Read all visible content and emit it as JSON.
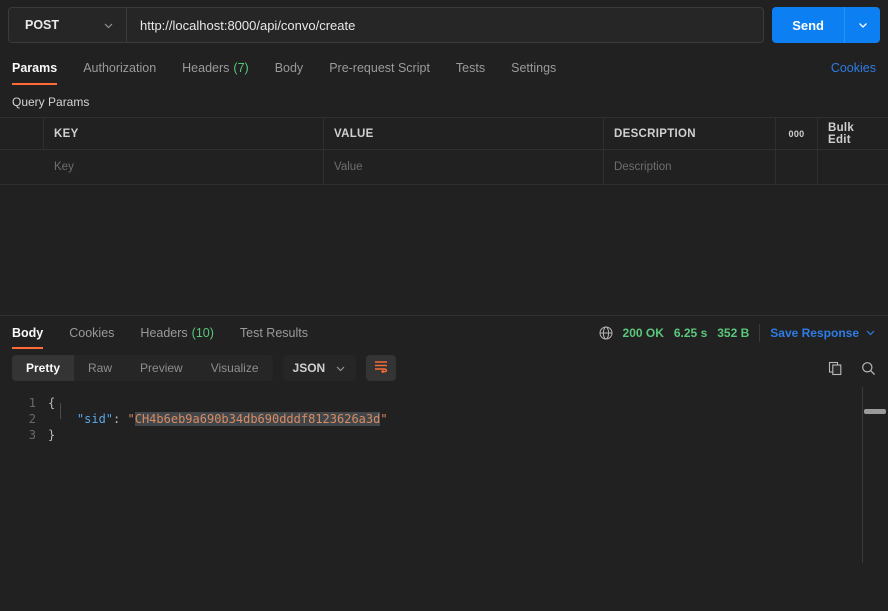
{
  "request": {
    "method": "POST",
    "url": "http://localhost:8000/api/convo/create",
    "send_label": "Send",
    "tabs": [
      {
        "label": "Params",
        "count": "",
        "active": true
      },
      {
        "label": "Authorization",
        "count": "",
        "active": false
      },
      {
        "label": "Headers",
        "count": "(7)",
        "active": false
      },
      {
        "label": "Body",
        "count": "",
        "active": false
      },
      {
        "label": "Pre-request Script",
        "count": "",
        "active": false
      },
      {
        "label": "Tests",
        "count": "",
        "active": false
      },
      {
        "label": "Settings",
        "count": "",
        "active": false
      }
    ],
    "cookies_link": "Cookies"
  },
  "params": {
    "section_title": "Query Params",
    "columns": [
      "KEY",
      "VALUE",
      "DESCRIPTION"
    ],
    "more_dots": "000",
    "bulk_edit": "Bulk Edit",
    "row_placeholders": [
      "Key",
      "Value",
      "Description"
    ]
  },
  "response": {
    "tabs": [
      {
        "label": "Body",
        "count": "",
        "active": true
      },
      {
        "label": "Cookies",
        "count": "",
        "active": false
      },
      {
        "label": "Headers",
        "count": "(10)",
        "active": false
      },
      {
        "label": "Test Results",
        "count": "",
        "active": false
      }
    ],
    "status": "200 OK",
    "time": "6.25 s",
    "size": "352 B",
    "save_label": "Save Response",
    "view_modes": [
      {
        "label": "Pretty",
        "active": true
      },
      {
        "label": "Raw",
        "active": false
      },
      {
        "label": "Preview",
        "active": false
      },
      {
        "label": "Visualize",
        "active": false
      }
    ],
    "format": "JSON",
    "icons": {
      "globe": "globe-icon",
      "wrap": "word-wrap-icon",
      "copy": "copy-icon",
      "search": "search-icon"
    },
    "body_lines": [
      {
        "num": "1",
        "type": "open"
      },
      {
        "num": "2",
        "type": "pair",
        "key": "\"sid\"",
        "colon": ": ",
        "value": "CH4b6eb9a690b34db690dddf8123626a3d"
      },
      {
        "num": "3",
        "type": "close"
      }
    ],
    "open_brace": "{",
    "close_brace": "}",
    "quote": "\""
  },
  "colors": {
    "accent": "#ff6c37",
    "send_blue": "#0c7ff2",
    "link_blue": "#2e7ce4",
    "green": "#5ac77b",
    "string": "#d98b62",
    "key_blue": "#58a6e8"
  }
}
